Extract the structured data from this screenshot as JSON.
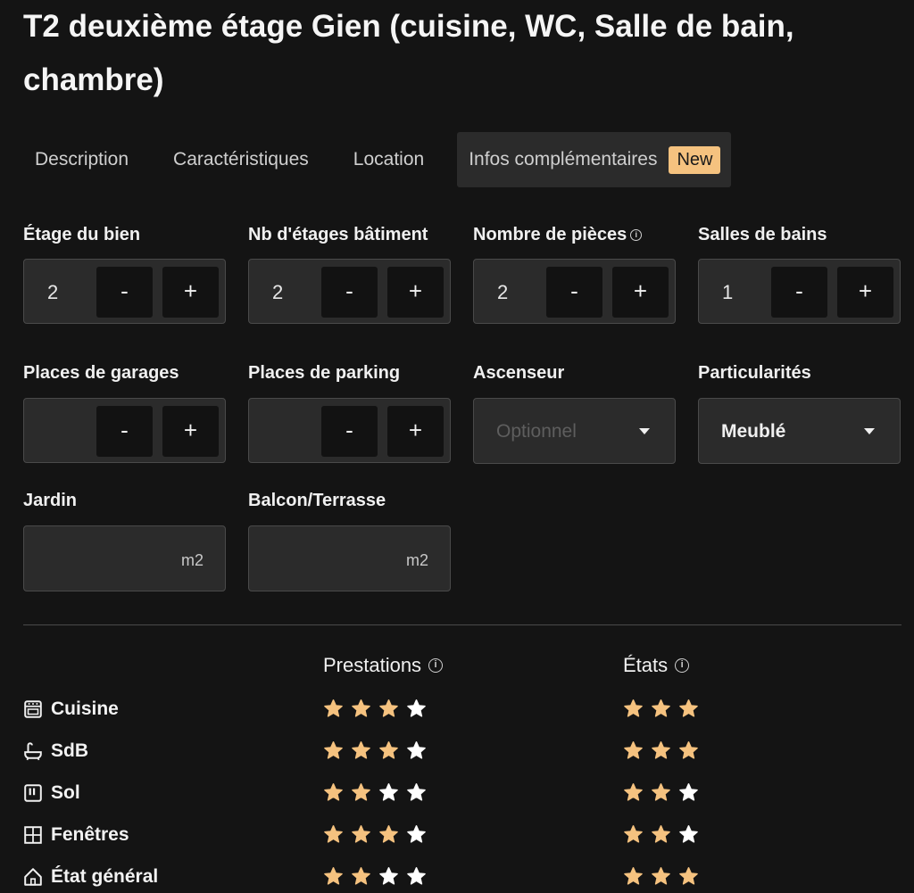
{
  "title": "T2 deuxième étage Gien (cuisine, WC, Salle de bain, chambre)",
  "tabs": [
    {
      "label": "Description"
    },
    {
      "label": "Caractéristiques"
    },
    {
      "label": "Location"
    },
    {
      "label": "Infos complémentaires",
      "badge": "New"
    }
  ],
  "fields": {
    "etage": {
      "label": "Étage du bien",
      "value": "2"
    },
    "nb_etages": {
      "label": "Nb d'étages bâtiment",
      "value": "2"
    },
    "pieces": {
      "label": "Nombre de pièces",
      "value": "2"
    },
    "sdb": {
      "label": "Salles de bains",
      "value": "1"
    },
    "garages": {
      "label": "Places de garages",
      "value": ""
    },
    "parking": {
      "label": "Places de parking",
      "value": ""
    },
    "ascenseur": {
      "label": "Ascenseur",
      "placeholder": "Optionnel"
    },
    "particularites": {
      "label": "Particularités",
      "value": "Meublé"
    },
    "jardin": {
      "label": "Jardin",
      "unit": "m2"
    },
    "balcon": {
      "label": "Balcon/Terrasse",
      "unit": "m2"
    }
  },
  "stepper": {
    "minus": "-",
    "plus": "+"
  },
  "ratings": {
    "prestations_header": "Prestations",
    "etats_header": "États",
    "rows": [
      {
        "label": "Cuisine",
        "icon": "oven-icon",
        "prestations": 3,
        "prestations_max": 4,
        "etats": 3,
        "etats_max": 3
      },
      {
        "label": "SdB",
        "icon": "bathtub-icon",
        "prestations": 3,
        "prestations_max": 4,
        "etats": 3,
        "etats_max": 3
      },
      {
        "label": "Sol",
        "icon": "floor-icon",
        "prestations": 2,
        "prestations_max": 4,
        "etats": 2,
        "etats_max": 3
      },
      {
        "label": "Fenêtres",
        "icon": "window-icon",
        "prestations": 3,
        "prestations_max": 4,
        "etats": 2,
        "etats_max": 3
      },
      {
        "label": "État général",
        "icon": "house-icon",
        "prestations": 2,
        "prestations_max": 4,
        "etats": 3,
        "etats_max": 3
      }
    ]
  },
  "colors": {
    "accent": "#f5c27f",
    "star_on": "#f5c27f",
    "star_off": "#ffffff",
    "background": "#141414",
    "field_bg": "#2b2b2b"
  }
}
